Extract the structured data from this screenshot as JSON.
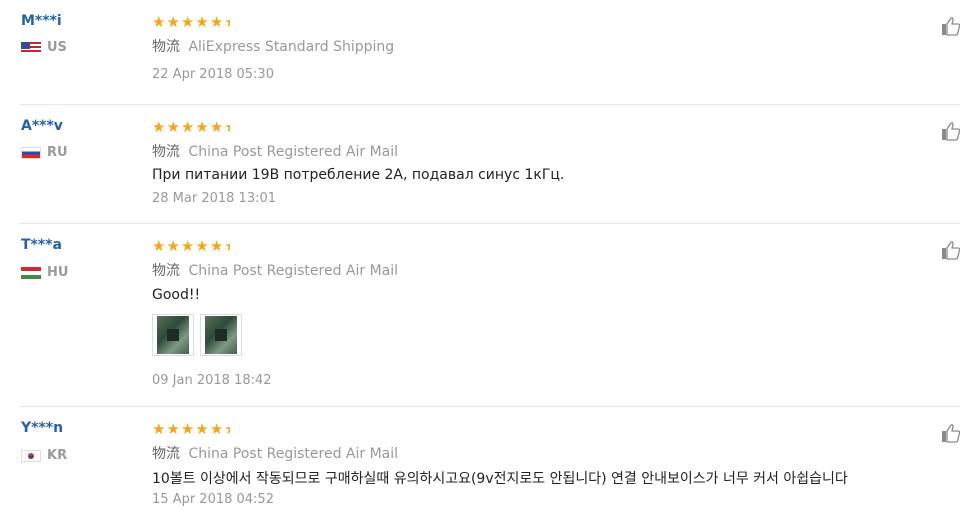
{
  "reviews": [
    {
      "user": "M***i",
      "country": "US",
      "rating": 5,
      "shipping_label": "物流",
      "shipping_method": "AliExpress Standard Shipping",
      "text": "",
      "date": "22 Apr 2018 05:30",
      "photos": []
    },
    {
      "user": "A***v",
      "country": "RU",
      "rating": 5,
      "shipping_label": "物流",
      "shipping_method": "China Post Registered Air Mail",
      "text": "При питании 19В потребление 2А, подавал синус 1кГц.",
      "date": "28 Mar 2018 13:01",
      "photos": []
    },
    {
      "user": "T***a",
      "country": "HU",
      "rating": 5,
      "shipping_label": "物流",
      "shipping_method": "China Post Registered Air Mail",
      "text": "Good!!",
      "date": "09 Jan 2018 18:42",
      "photos": [
        "review-photo-1",
        "review-photo-2"
      ]
    },
    {
      "user": "Y***n",
      "country": "KR",
      "rating": 5,
      "shipping_label": "物流",
      "shipping_method": "China Post Registered Air Mail",
      "text": "10볼트 이상에서 작동되므로 구매하실때 유의하시고요(9v전지로도 안됩니다) 연결 안내보이스가 너무 커서 아쉽습니다",
      "date": "15 Apr 2018 04:52",
      "photos": []
    }
  ],
  "icons": {
    "star": "star-icon",
    "helpful": "thumbs-up-icon"
  },
  "colors": {
    "star": "#f7a51c",
    "username": "#2661a8"
  }
}
